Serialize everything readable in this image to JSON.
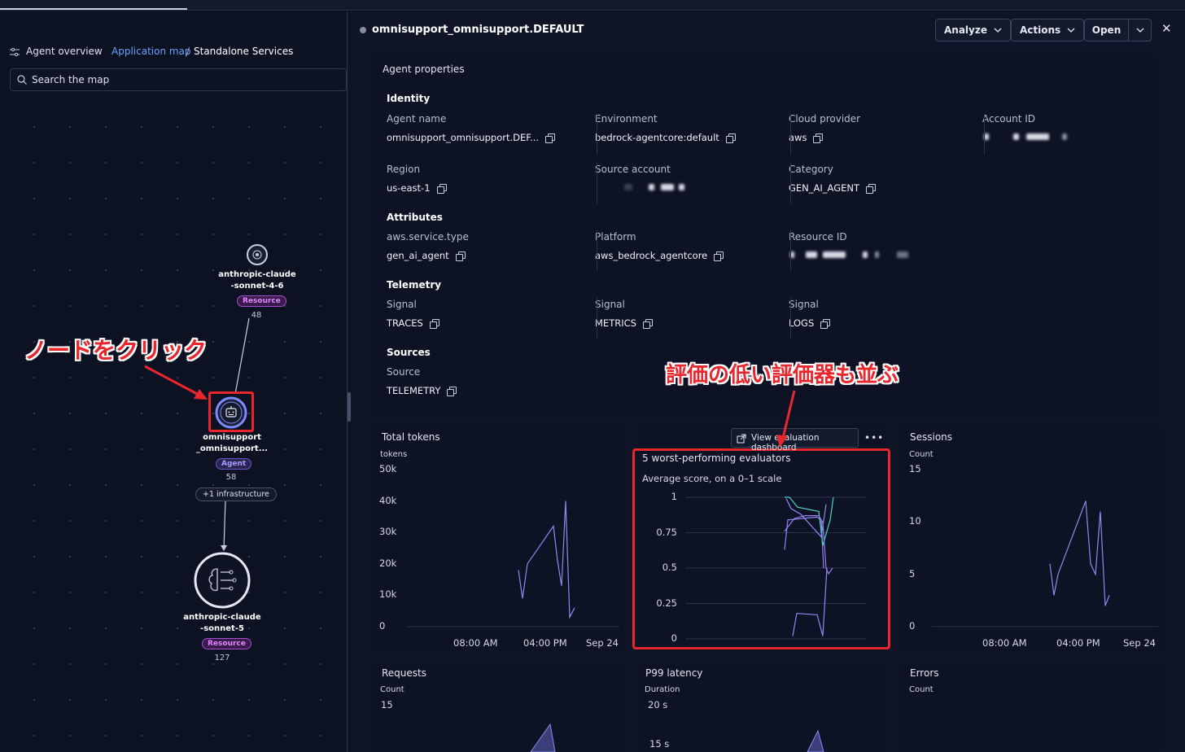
{
  "breadcrumb": {
    "agent_overview": "Agent overview",
    "application_map": "Application map",
    "separator": "/",
    "standalone": "Standalone Services"
  },
  "map": {
    "search_placeholder": "Search the map",
    "nodes": [
      {
        "line1": "anthropic-claude",
        "line2": "-sonnet-4-6",
        "badge": "Resource",
        "count": "48"
      },
      {
        "line1": "omnisupport",
        "line2": "_omnisupport...",
        "badge": "Agent",
        "count": "58",
        "pill": "+1 infrastructure"
      },
      {
        "line1": "anthropic-claude",
        "line2": "-sonnet-5",
        "badge": "Resource",
        "count": "127"
      }
    ],
    "annotation": "ノードをクリック"
  },
  "panel": {
    "title": "omnisupport_omnisupport.DEFAULT",
    "buttons": {
      "analyze": "Analyze",
      "actions": "Actions",
      "open": "Open"
    },
    "close": "✕",
    "card_title": "Agent properties",
    "identity": {
      "title": "Identity",
      "fields": [
        {
          "label": "Agent name",
          "value": "omnisupport_omnisupport.DEF..."
        },
        {
          "label": "Environment",
          "value": "bedrock-agentcore:default"
        },
        {
          "label": "Cloud provider",
          "value": "aws"
        },
        {
          "label": "Account ID",
          "value": ""
        },
        {
          "label": "Region",
          "value": "us-east-1"
        },
        {
          "label": "Source account",
          "value": ""
        },
        {
          "label": "Category",
          "value": "GEN_AI_AGENT"
        }
      ]
    },
    "attributes": {
      "title": "Attributes",
      "fields": [
        {
          "label": "aws.service.type",
          "value": "gen_ai_agent"
        },
        {
          "label": "Platform",
          "value": "aws_bedrock_agentcore"
        },
        {
          "label": "Resource ID",
          "value": ""
        }
      ]
    },
    "telemetry": {
      "title": "Telemetry",
      "fields": [
        {
          "label": "Signal",
          "value": "TRACES"
        },
        {
          "label": "Signal",
          "value": "METRICS"
        },
        {
          "label": "Signal",
          "value": "LOGS"
        }
      ]
    },
    "sources": {
      "title": "Sources",
      "fields": [
        {
          "label": "Source",
          "value": "TELEMETRY"
        }
      ]
    },
    "annotation": "評価の低い評価器も並ぶ",
    "eval_button": "View evaluation dashboard",
    "more": "•••"
  },
  "chart_data": [
    {
      "type": "line",
      "title": "Total tokens",
      "ylabel": "tokens",
      "yticks": [
        "50k",
        "40k",
        "30k",
        "20k",
        "10k",
        "0"
      ],
      "xticks": [
        "08:00 AM",
        "04:00 PM",
        "Sep 24"
      ],
      "ylim": [
        0,
        50000
      ],
      "series": [
        {
          "values": [
            18000,
            9000,
            20000,
            32000,
            21000,
            13000,
            40000,
            3000,
            6000
          ]
        }
      ]
    },
    {
      "type": "line",
      "title": "5 worst-performing evaluators",
      "subtitle": "Average score, on a 0–1 scale",
      "yticks": [
        "1",
        "0.75",
        "0.5",
        "0.25",
        "0"
      ],
      "ylim": [
        0,
        1
      ],
      "series": [
        {
          "values": [
            0.63,
            0.84,
            0.86,
            0.84,
            0.5
          ]
        },
        {
          "values": [
            1.0,
            1.0,
            0.93,
            0.9,
            0.66,
            0.84,
            1.0
          ]
        },
        {
          "values": [
            0.99,
            0.92,
            0.88,
            0.72,
            0.95
          ]
        },
        {
          "values": [
            0.76,
            0.85,
            0.87,
            0.87,
            0.82,
            0.5,
            0.46,
            0.5
          ]
        },
        {
          "values": [
            0.02,
            0.18,
            0.17,
            0.02,
            0.5
          ]
        }
      ]
    },
    {
      "type": "line",
      "title": "Sessions",
      "ylabel": "Count",
      "yticks": [
        "15",
        "10",
        "5",
        "0"
      ],
      "xticks": [
        "08:00 AM",
        "04:00 PM",
        "Sep 24"
      ],
      "ylim": [
        0,
        15
      ],
      "series": [
        {
          "values": [
            6,
            3,
            5,
            12,
            6,
            5,
            11,
            2,
            3
          ]
        }
      ]
    },
    {
      "type": "area",
      "title": "Requests",
      "ylabel": "Count",
      "yticks": [
        "15"
      ]
    },
    {
      "type": "area",
      "title": "P99 latency",
      "ylabel": "Duration",
      "yticks": [
        "20 s",
        "15 s"
      ]
    },
    {
      "type": "line",
      "title": "Errors",
      "ylabel": "Count"
    }
  ],
  "colors": {
    "accent": "#6aa1ff",
    "series": "#8b8cf2",
    "annotation": "#e8262e"
  }
}
